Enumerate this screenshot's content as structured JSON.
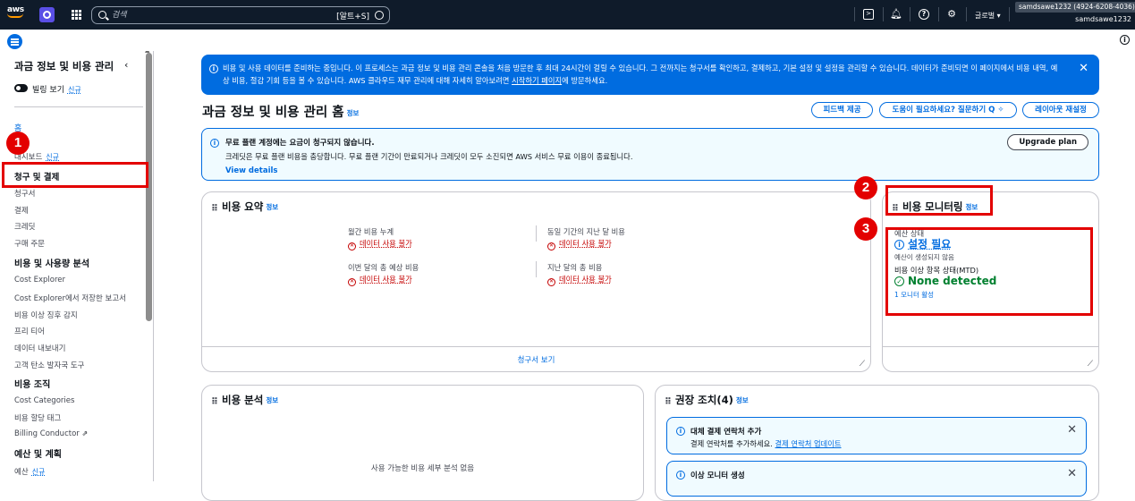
{
  "topnav": {
    "logo_text": "aws",
    "search_placeholder": "검색",
    "search_shortcut": "[알트+S]",
    "region": "글로벌",
    "account_tag": "samdsawe1232 (4924-6208-4036)",
    "account_name": "samdsawe1232"
  },
  "sidebar": {
    "title": "과금 정보 및 비용 관리",
    "toggle_label": "빌링 보기",
    "new_badge": "신규",
    "home": "홈",
    "dashboard": "대시보드",
    "billing_head": "청구 및 결제",
    "billing_items": [
      "청구서",
      "결제",
      "크레딧",
      "구매 주문"
    ],
    "analysis_head": "비용 및 사용량 분석",
    "analysis_items": [
      "Cost Explorer",
      "Cost Explorer에서 저장한 보고서",
      "비용 이상 징후 감지",
      "프리 티어",
      "데이터 내보내기",
      "고객 탄소 발자국 도구"
    ],
    "org_head": "비용 조직",
    "org_items": [
      "Cost Categories",
      "비용 할당 태그",
      "Billing Conductor"
    ],
    "budget_head": "예산 및 계획",
    "budget_item": "예산"
  },
  "flash": {
    "text_before": "비용 및 사용 데이터를 준비하는 중입니다. 이 프로세스는 과금 정보 및 비용 관리 콘솔을 처음 방문한 후 최대 24시간이 걸릴 수 있습니다. 그 전까지는 청구서를 확인하고, 결제하고, 기본 설정 및 설정을 관리할 수 있습니다. 데이터가 준비되면 이 페이지에서 비용 내역, 예상 비용, 절감 기회 등을 볼 수 있습니다. AWS 클라우드 재무 관리에 대해 자세히 알아보려면 ",
    "link": "시작하기 페이지",
    "text_after": "에 방문하세요."
  },
  "header": {
    "title": "과금 정보 및 비용 관리 홈",
    "info": "정보",
    "feedback": "피드백 제공",
    "help": "도움이 필요하세요? 질문하기 Q",
    "reset_layout": "레이아웃 재설정"
  },
  "alert": {
    "title": "무료 플랜 계정에는 요금이 청구되지 않습니다.",
    "body": "크레딧은 무료 플랜 비용을 충당합니다. 무료 플랜 기간이 만료되거나 크레딧이 모두 소진되면 AWS 서비스 무료 이용이 종료됩니다.",
    "link": "View details",
    "button": "Upgrade plan"
  },
  "cost_summary": {
    "title": "비용 요약",
    "info": "정보",
    "metrics": [
      "월간 비용 누계",
      "동일 기간의 지난 달 비용",
      "이번 달의 총 예상 비용",
      "지난 달의 총 비용"
    ],
    "unavailable": "데이터 사용 불가",
    "footer_link": "청구서 보기"
  },
  "cost_monitoring": {
    "title": "비용 모니터링",
    "info": "정보",
    "budget_label": "예산 상태",
    "budget_status": "설정 필요",
    "budget_sub": "예산이 생성되지 않음",
    "anomaly_label": "비용 이상 항목 상태(MTD)",
    "anomaly_status": "None detected",
    "monitor_link": "1 모니터 활성"
  },
  "cost_analysis": {
    "title": "비용 분석",
    "info": "정보",
    "empty": "사용 가능한 비용 세부 분석 없음"
  },
  "recommendations": {
    "title": "권장 조치(4)",
    "info": "정보",
    "items": [
      {
        "title": "대체 결제 연락처 추가",
        "desc": "결제 연락처를 추가하세요.",
        "link": "결제 연락처 업데이트"
      },
      {
        "title": "이상 모니터 생성"
      }
    ]
  },
  "annotations": [
    "1",
    "2",
    "3"
  ],
  "colors": {
    "accent": "#006ce0",
    "error": "#c40000",
    "success": "#00802f",
    "annotation": "#e30000",
    "nav_bg": "#0f1b2a"
  }
}
